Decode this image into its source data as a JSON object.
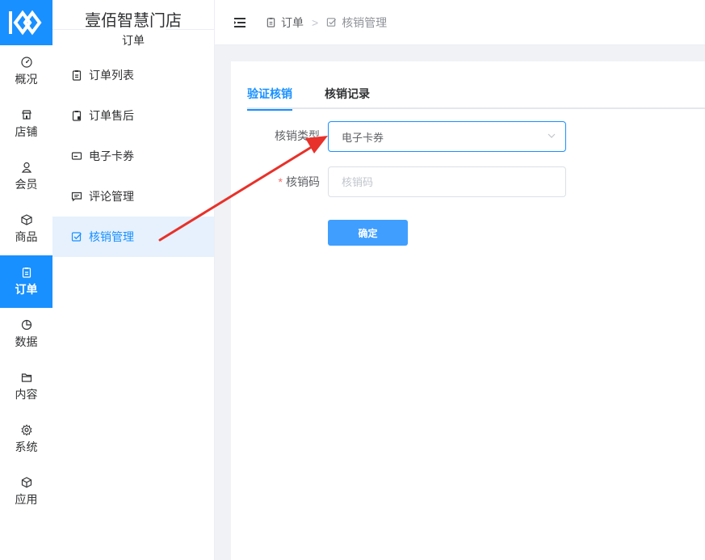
{
  "app": {
    "store_name": "壹佰智慧门店"
  },
  "rail": {
    "items": [
      {
        "label": "概况",
        "icon": "gauge-icon"
      },
      {
        "label": "店铺",
        "icon": "store-icon"
      },
      {
        "label": "会员",
        "icon": "user-icon"
      },
      {
        "label": "商品",
        "icon": "box-icon"
      },
      {
        "label": "订单",
        "icon": "clipboard-icon",
        "active": true
      },
      {
        "label": "数据",
        "icon": "pie-chart-icon"
      },
      {
        "label": "内容",
        "icon": "folder-icon"
      },
      {
        "label": "系统",
        "icon": "gear-icon"
      },
      {
        "label": "应用",
        "icon": "cube-icon"
      }
    ]
  },
  "sidebar": {
    "group_title": "订单",
    "items": [
      {
        "label": "订单列表",
        "icon": "clipboard-icon"
      },
      {
        "label": "订单售后",
        "icon": "clipboard-lock-icon"
      },
      {
        "label": "电子卡券",
        "icon": "card-icon"
      },
      {
        "label": "评论管理",
        "icon": "comment-icon"
      },
      {
        "label": "核销管理",
        "icon": "check-square-icon",
        "active": true
      }
    ]
  },
  "breadcrumb": {
    "level1": "订单",
    "separator": ">",
    "level2": "核销管理"
  },
  "tabs": [
    {
      "label": "验证核销",
      "active": true
    },
    {
      "label": "核销记录"
    }
  ],
  "form": {
    "type_label": "核销类型",
    "type_value": "电子卡券",
    "code_label": "核销码",
    "code_required_mark": "*",
    "code_placeholder": "核销码",
    "submit_label": "确定"
  },
  "colors": {
    "accent": "#1890ff",
    "button": "#409eff",
    "arrow": "#e8312a"
  }
}
